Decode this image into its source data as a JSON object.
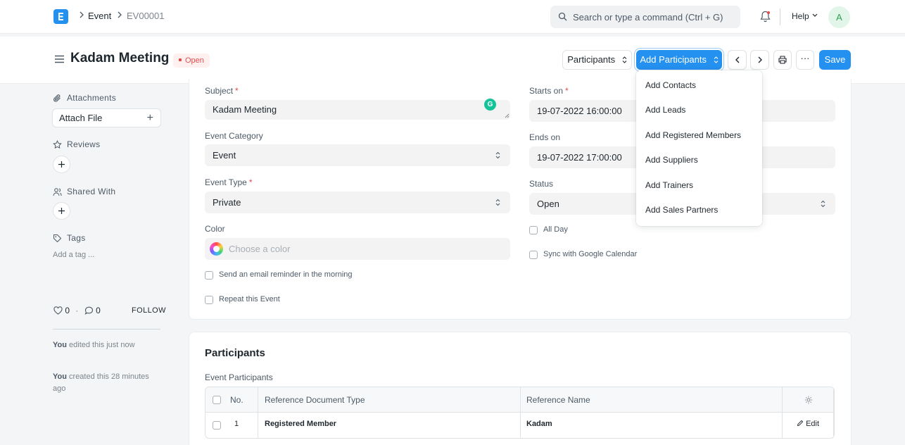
{
  "navbar": {
    "breadcrumbs": [
      "Event",
      "EV00001"
    ],
    "search_placeholder": "Search or type a command (Ctrl + G)",
    "help_label": "Help",
    "avatar_initial": "A"
  },
  "page": {
    "title": "Kadam Meeting",
    "status": "Open",
    "participants_select": "Participants",
    "add_participants_label": "Add Participants",
    "more_label": "···",
    "save_label": "Save"
  },
  "sidebar": {
    "attachments_label": "Attachments",
    "attach_file_label": "Attach File",
    "reviews_label": "Reviews",
    "shared_with_label": "Shared With",
    "tags_label": "Tags",
    "add_tag_label": "Add a tag ...",
    "likes_count": "0",
    "comments_count": "0",
    "separator": "·",
    "follow_label": "FOLLOW",
    "activity": [
      {
        "who": "You",
        "text": " edited this just now"
      },
      {
        "who": "You",
        "text": " created this 28 minutes ago"
      }
    ]
  },
  "form": {
    "subject": {
      "label": "Subject",
      "value": "Kadam Meeting"
    },
    "event_category": {
      "label": "Event Category",
      "value": "Event"
    },
    "event_type": {
      "label": "Event Type",
      "value": "Private"
    },
    "color": {
      "label": "Color",
      "placeholder": "Choose a color"
    },
    "send_reminder_label": "Send an email reminder in the morning",
    "repeat_label": "Repeat this Event",
    "starts_on": {
      "label": "Starts on",
      "value": "19-07-2022 16:00:00"
    },
    "ends_on": {
      "label": "Ends on",
      "value": "19-07-2022 17:00:00"
    },
    "status": {
      "label": "Status",
      "value": "Open"
    },
    "all_day_label": "All Day",
    "sync_google_label": "Sync with Google Calendar",
    "required_mark": "*"
  },
  "dropdown": {
    "items": [
      "Add Contacts",
      "Add Leads",
      "Add Registered Members",
      "Add Suppliers",
      "Add Trainers",
      "Add Sales Partners"
    ]
  },
  "participants": {
    "section_title": "Participants",
    "table_label": "Event Participants",
    "columns": [
      "No.",
      "Reference Document Type",
      "Reference Name"
    ],
    "rows": [
      {
        "no": "1",
        "doc_type": "Registered Member",
        "name": "Kadam",
        "edit_label": "Edit"
      }
    ]
  },
  "colors": {
    "primary": "#2490ef",
    "danger": "#e24c4c"
  }
}
